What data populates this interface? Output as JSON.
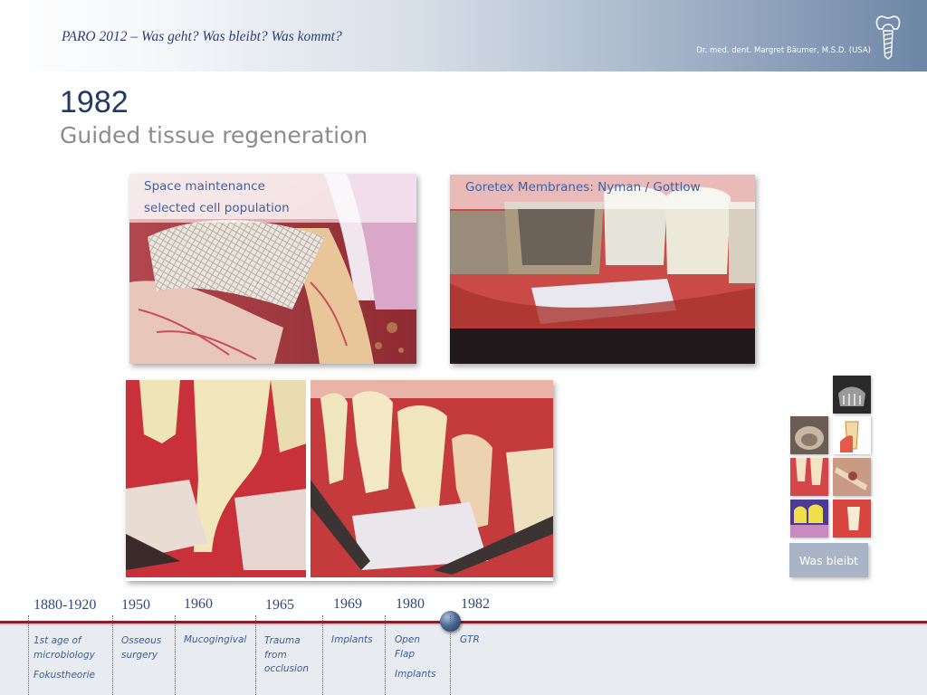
{
  "header": {
    "title": "PARO 2012 – Was geht? Was bleibt? Was kommt?",
    "author": "Dr. med. dent. Margret Bäumer, M.S.D. (USA)",
    "logo_icon": "tooth-implant-icon"
  },
  "slide": {
    "year": "1982",
    "subtitle": "Guided tissue regeneration"
  },
  "images": {
    "illustration": {
      "caption_line1": "Space maintenance",
      "caption_line2": "selected cell population"
    },
    "membrane_photo": {
      "caption": "Goretex Membranes: Nyman / Gottlow"
    }
  },
  "nav": {
    "was_bleibt_label": "Was bleibt"
  },
  "timeline": {
    "accent_color": "#8b1d2c",
    "current": "1982",
    "items": [
      {
        "year": "1880-1920",
        "lines": [
          "1st age of",
          "microbiology"
        ],
        "extra": "Fokustheorie"
      },
      {
        "year": "1950",
        "lines": [
          "Osseous",
          "surgery"
        ]
      },
      {
        "year": "1960",
        "lines": [
          "Mucogingival"
        ]
      },
      {
        "year": "1965",
        "lines": [
          "Trauma",
          "from",
          "occlusion"
        ]
      },
      {
        "year": "1969",
        "lines": [
          "Implants"
        ]
      },
      {
        "year": "1980",
        "lines": [
          "Open",
          "Flap"
        ],
        "extra": "Implants"
      },
      {
        "year": "1982",
        "lines": [
          "GTR"
        ]
      }
    ]
  }
}
